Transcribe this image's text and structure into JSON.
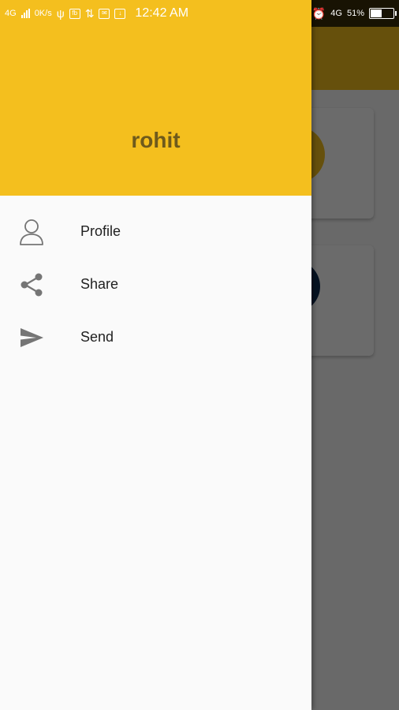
{
  "status_bar": {
    "network_left": "4G",
    "data_speed": "0K/s",
    "time": "12:42 AM",
    "network_right": "4G",
    "battery_percent": "51%",
    "battery_level": 0.51
  },
  "drawer": {
    "username": "rohit",
    "header_color": "#f4bf1e",
    "items": [
      {
        "label": "Profile",
        "icon": "person-icon"
      },
      {
        "label": "Share",
        "icon": "share-icon"
      },
      {
        "label": "Send",
        "icon": "send-icon"
      }
    ]
  },
  "colors": {
    "accent": "#f4bf1e",
    "username_text": "#6e5a1c",
    "icon_gray": "#757575"
  }
}
